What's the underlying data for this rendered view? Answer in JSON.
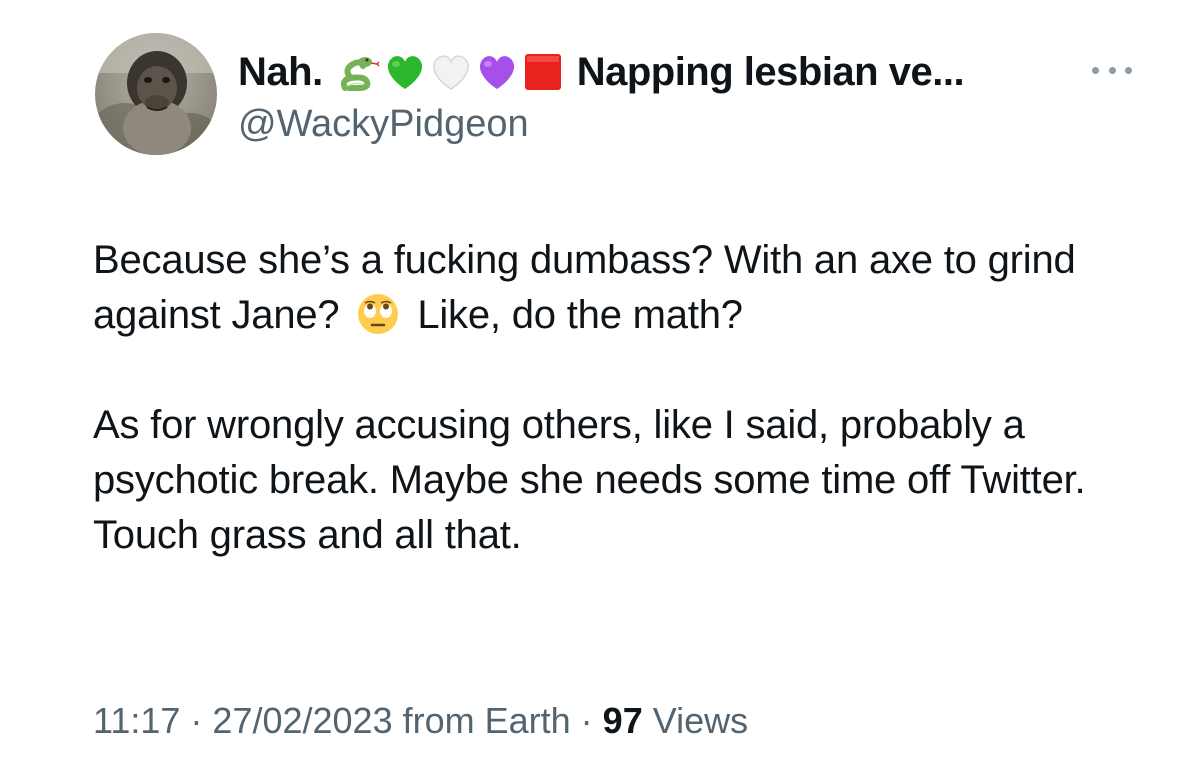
{
  "author": {
    "display_name": "Nah.",
    "display_name_suffix": "Napping lesbian ve...",
    "handle": "@WackyPidgeon",
    "name_emojis": [
      "snake-emoji",
      "green-heart-emoji",
      "white-heart-emoji",
      "purple-heart-emoji",
      "red-square-emoji"
    ]
  },
  "tweet": {
    "para1_part1": "Because she’s a fucking dumbass? With an axe to grind against Jane?",
    "para1_emoji": "face-with-rolling-eyes-emoji",
    "para1_part2": "Like, do the math?",
    "para2": "As for wrongly accusing others, like I said, probably a psychotic break. Maybe she needs some time off Twitter. Touch grass and all that."
  },
  "meta": {
    "time": "11:17",
    "separator1": " · ",
    "date": "27/02/2023",
    "source": " from Earth",
    "separator2": " · ",
    "views_count": "97",
    "views_label": " Views"
  },
  "colors": {
    "primary_text": "#0f1419",
    "secondary_text": "#536471"
  }
}
